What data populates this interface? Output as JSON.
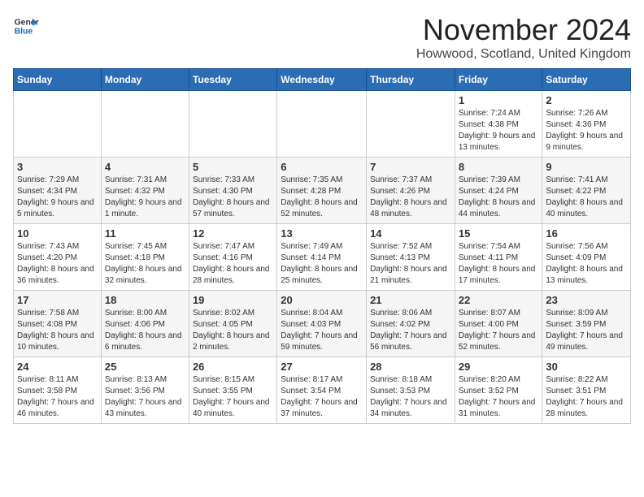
{
  "header": {
    "logo_line1": "General",
    "logo_line2": "Blue",
    "month": "November 2024",
    "location": "Howwood, Scotland, United Kingdom"
  },
  "weekdays": [
    "Sunday",
    "Monday",
    "Tuesday",
    "Wednesday",
    "Thursday",
    "Friday",
    "Saturday"
  ],
  "weeks": [
    [
      {
        "day": "",
        "detail": ""
      },
      {
        "day": "",
        "detail": ""
      },
      {
        "day": "",
        "detail": ""
      },
      {
        "day": "",
        "detail": ""
      },
      {
        "day": "",
        "detail": ""
      },
      {
        "day": "1",
        "detail": "Sunrise: 7:24 AM\nSunset: 4:38 PM\nDaylight: 9 hours and 13 minutes."
      },
      {
        "day": "2",
        "detail": "Sunrise: 7:26 AM\nSunset: 4:36 PM\nDaylight: 9 hours and 9 minutes."
      }
    ],
    [
      {
        "day": "3",
        "detail": "Sunrise: 7:29 AM\nSunset: 4:34 PM\nDaylight: 9 hours and 5 minutes."
      },
      {
        "day": "4",
        "detail": "Sunrise: 7:31 AM\nSunset: 4:32 PM\nDaylight: 9 hours and 1 minute."
      },
      {
        "day": "5",
        "detail": "Sunrise: 7:33 AM\nSunset: 4:30 PM\nDaylight: 8 hours and 57 minutes."
      },
      {
        "day": "6",
        "detail": "Sunrise: 7:35 AM\nSunset: 4:28 PM\nDaylight: 8 hours and 52 minutes."
      },
      {
        "day": "7",
        "detail": "Sunrise: 7:37 AM\nSunset: 4:26 PM\nDaylight: 8 hours and 48 minutes."
      },
      {
        "day": "8",
        "detail": "Sunrise: 7:39 AM\nSunset: 4:24 PM\nDaylight: 8 hours and 44 minutes."
      },
      {
        "day": "9",
        "detail": "Sunrise: 7:41 AM\nSunset: 4:22 PM\nDaylight: 8 hours and 40 minutes."
      }
    ],
    [
      {
        "day": "10",
        "detail": "Sunrise: 7:43 AM\nSunset: 4:20 PM\nDaylight: 8 hours and 36 minutes."
      },
      {
        "day": "11",
        "detail": "Sunrise: 7:45 AM\nSunset: 4:18 PM\nDaylight: 8 hours and 32 minutes."
      },
      {
        "day": "12",
        "detail": "Sunrise: 7:47 AM\nSunset: 4:16 PM\nDaylight: 8 hours and 28 minutes."
      },
      {
        "day": "13",
        "detail": "Sunrise: 7:49 AM\nSunset: 4:14 PM\nDaylight: 8 hours and 25 minutes."
      },
      {
        "day": "14",
        "detail": "Sunrise: 7:52 AM\nSunset: 4:13 PM\nDaylight: 8 hours and 21 minutes."
      },
      {
        "day": "15",
        "detail": "Sunrise: 7:54 AM\nSunset: 4:11 PM\nDaylight: 8 hours and 17 minutes."
      },
      {
        "day": "16",
        "detail": "Sunrise: 7:56 AM\nSunset: 4:09 PM\nDaylight: 8 hours and 13 minutes."
      }
    ],
    [
      {
        "day": "17",
        "detail": "Sunrise: 7:58 AM\nSunset: 4:08 PM\nDaylight: 8 hours and 10 minutes."
      },
      {
        "day": "18",
        "detail": "Sunrise: 8:00 AM\nSunset: 4:06 PM\nDaylight: 8 hours and 6 minutes."
      },
      {
        "day": "19",
        "detail": "Sunrise: 8:02 AM\nSunset: 4:05 PM\nDaylight: 8 hours and 2 minutes."
      },
      {
        "day": "20",
        "detail": "Sunrise: 8:04 AM\nSunset: 4:03 PM\nDaylight: 7 hours and 59 minutes."
      },
      {
        "day": "21",
        "detail": "Sunrise: 8:06 AM\nSunset: 4:02 PM\nDaylight: 7 hours and 56 minutes."
      },
      {
        "day": "22",
        "detail": "Sunrise: 8:07 AM\nSunset: 4:00 PM\nDaylight: 7 hours and 52 minutes."
      },
      {
        "day": "23",
        "detail": "Sunrise: 8:09 AM\nSunset: 3:59 PM\nDaylight: 7 hours and 49 minutes."
      }
    ],
    [
      {
        "day": "24",
        "detail": "Sunrise: 8:11 AM\nSunset: 3:58 PM\nDaylight: 7 hours and 46 minutes."
      },
      {
        "day": "25",
        "detail": "Sunrise: 8:13 AM\nSunset: 3:56 PM\nDaylight: 7 hours and 43 minutes."
      },
      {
        "day": "26",
        "detail": "Sunrise: 8:15 AM\nSunset: 3:55 PM\nDaylight: 7 hours and 40 minutes."
      },
      {
        "day": "27",
        "detail": "Sunrise: 8:17 AM\nSunset: 3:54 PM\nDaylight: 7 hours and 37 minutes."
      },
      {
        "day": "28",
        "detail": "Sunrise: 8:18 AM\nSunset: 3:53 PM\nDaylight: 7 hours and 34 minutes."
      },
      {
        "day": "29",
        "detail": "Sunrise: 8:20 AM\nSunset: 3:52 PM\nDaylight: 7 hours and 31 minutes."
      },
      {
        "day": "30",
        "detail": "Sunrise: 8:22 AM\nSunset: 3:51 PM\nDaylight: 7 hours and 28 minutes."
      }
    ]
  ]
}
